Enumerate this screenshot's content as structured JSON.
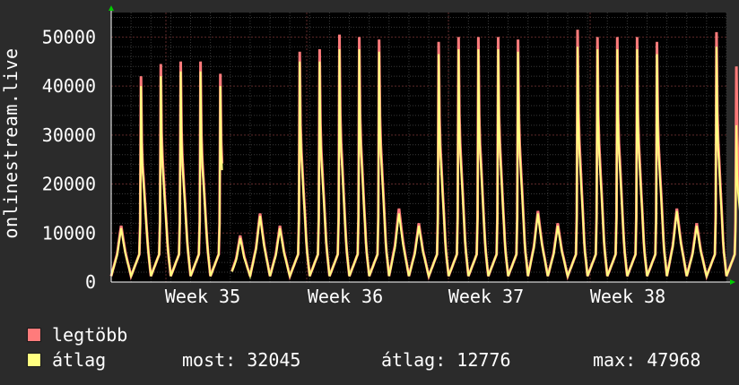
{
  "chart_data": {
    "type": "area",
    "ylabel": "onlinestream.live",
    "ylim": [
      0,
      55000
    ],
    "yticks": [
      "0",
      "10000",
      "20000",
      "30000",
      "40000",
      "50000"
    ],
    "ytick_values": [
      0,
      10000,
      20000,
      30000,
      40000,
      50000
    ],
    "xticks": [
      "Week 35",
      "Week 36",
      "Week 37",
      "Week 38"
    ],
    "grid": true,
    "series": [
      {
        "name": "legtöbb",
        "color": "#ff7b7b",
        "daily_peaks": [
          11500,
          42000,
          44500,
          45000,
          45000,
          42500,
          9500,
          14000,
          11500,
          47000,
          47500,
          50500,
          50000,
          49500,
          15000,
          12000,
          49000,
          50000,
          50000,
          50000,
          49500,
          14500,
          12000,
          51500,
          50000,
          50000,
          50000,
          49000,
          15000,
          12000,
          51000,
          44000
        ]
      },
      {
        "name": "átlag",
        "color": "#ffff80",
        "daily_peaks": [
          11000,
          40000,
          42000,
          43000,
          43000,
          40000,
          9000,
          13500,
          11000,
          45000,
          45000,
          47500,
          47500,
          47000,
          14000,
          11500,
          46500,
          47500,
          47500,
          47500,
          47000,
          14000,
          11500,
          48000,
          47500,
          47500,
          47500,
          46500,
          14500,
          11500,
          48000,
          32000
        ]
      }
    ]
  },
  "legend": {
    "max_label": "legtöbb",
    "avg_label": "átlag",
    "now": "most: 32045",
    "average": "átlag: 12776",
    "maximum": "max: 47968"
  }
}
